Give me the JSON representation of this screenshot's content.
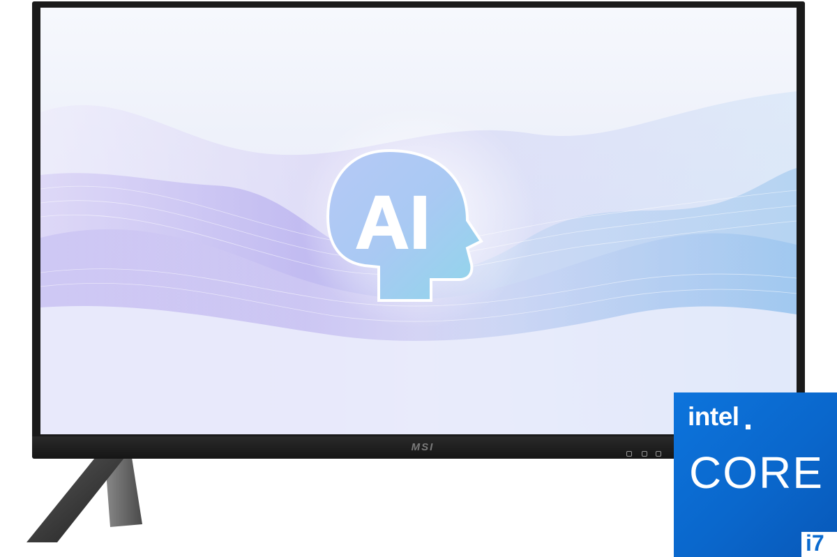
{
  "product": {
    "brand_logo": "MSI",
    "screen_badge": "AI",
    "colors": {
      "bezel": "#1a1a1a",
      "screen_bg": "#eef1fa",
      "wave_purple": "#b9b3f0",
      "wave_blue": "#9fc6ef",
      "intel_blue": "#0a6bd0"
    }
  },
  "intel_badge": {
    "brand": "intel",
    "line": "CORE",
    "tier": "i7"
  }
}
